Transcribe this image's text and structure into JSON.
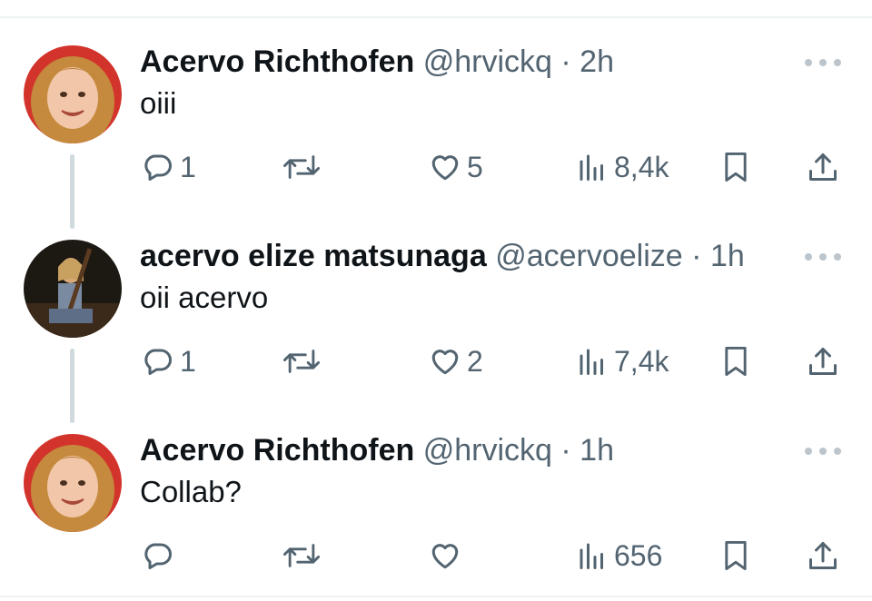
{
  "colors": {
    "text": "#0f1419",
    "secondary": "#536471",
    "divider": "#eff3f4",
    "thread": "#cfd9de"
  },
  "tweets": [
    {
      "name": "Acervo Richthofen",
      "handle": "@hrvickq",
      "dot": "·",
      "time": "2h",
      "text": "oiii",
      "replies": "1",
      "retweets": "",
      "likes": "5",
      "views": "8,4k",
      "avatar": "young woman with reddish hair, smiling",
      "thread": true
    },
    {
      "name": "acervo elize matsunaga",
      "handle": "@acervoelize",
      "dot": "·",
      "time": "1h",
      "text": "oii acervo",
      "replies": "1",
      "retweets": "",
      "likes": "2",
      "views": "7,4k",
      "avatar": "woman holding a rifle outdoors at night",
      "thread": true
    },
    {
      "name": "Acervo Richthofen",
      "handle": "@hrvickq",
      "dot": "·",
      "time": "1h",
      "text": "Collab?",
      "replies": "",
      "retweets": "",
      "likes": "",
      "views": "656",
      "avatar": "young woman with reddish hair, smiling",
      "thread": false
    }
  ],
  "icons": [
    "reply-icon",
    "retweet-icon",
    "like-icon",
    "views-icon",
    "bookmark-icon",
    "share-icon",
    "more-icon"
  ]
}
